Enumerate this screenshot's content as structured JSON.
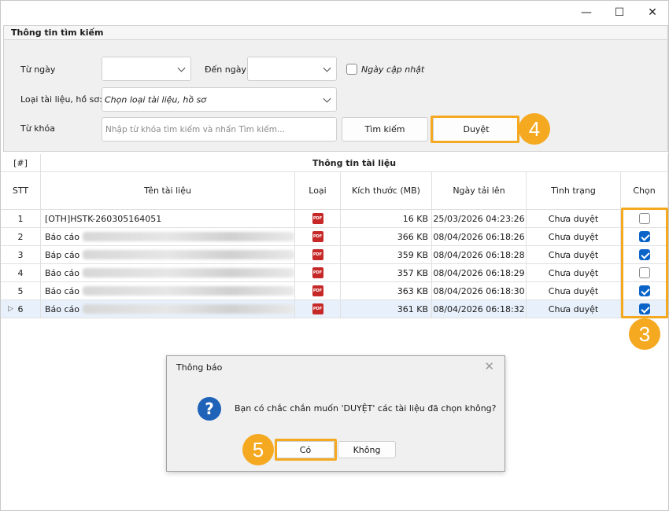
{
  "window": {
    "minimize_glyph": "—",
    "maximize_glyph": "☐",
    "close_glyph": "✕"
  },
  "search": {
    "title": "Thông tin tìm kiếm",
    "from_date_label": "Từ ngày",
    "to_date_label": "Đến ngày",
    "update_date_label": "Ngày cập nhật",
    "doc_type_label": "Loại tài liệu, hồ sơ:",
    "doc_type_value": "Chọn loại tài liệu, hồ sơ",
    "keyword_label": "Từ khóa",
    "keyword_placeholder": "Nhập từ khóa tìm kiếm và nhấn Tìm kiếm...",
    "search_button": "Tìm kiếm",
    "approve_button": "Duyệt"
  },
  "grid": {
    "corner": "[#]",
    "group_header": "Thông tin tài liệu",
    "columns": {
      "stt": "STT",
      "name": "Tên tài liệu",
      "type": "Loại",
      "size": "Kích thước (MB)",
      "date": "Ngày tải lên",
      "status": "Tình trạng",
      "select": "Chọn"
    },
    "rows": [
      {
        "stt": "1",
        "name": "[OTH]HSTK-260305164051",
        "blurred": false,
        "size": "16 KB",
        "date": "25/03/2026 04:23:26",
        "status": "Chưa duyệt",
        "checked": false
      },
      {
        "stt": "2",
        "name": "Báo cáo",
        "blurred": true,
        "size": "366 KB",
        "date": "08/04/2026 06:18:26",
        "status": "Chưa duyệt",
        "checked": true
      },
      {
        "stt": "3",
        "name": "Báp cáo",
        "blurred": true,
        "size": "359 KB",
        "date": "08/04/2026 06:18:28",
        "status": "Chưa duyệt",
        "checked": true
      },
      {
        "stt": "4",
        "name": "Báo cáo",
        "blurred": true,
        "size": "357 KB",
        "date": "08/04/2026 06:18:29",
        "status": "Chưa duyệt",
        "checked": false
      },
      {
        "stt": "5",
        "name": "Báo cáo",
        "blurred": true,
        "size": "363 KB",
        "date": "08/04/2026 06:18:30",
        "status": "Chưa duyệt",
        "checked": true
      },
      {
        "stt": "6",
        "name": "Báo cáo",
        "blurred": true,
        "size": "361 KB",
        "date": "08/04/2026 06:18:32",
        "status": "Chưa duyệt",
        "checked": true,
        "current": true
      }
    ],
    "row_indicator": "▷"
  },
  "dialog": {
    "title": "Thông báo",
    "close_glyph": "✕",
    "icon_glyph": "?",
    "message": "Bạn có chắc chắn muốn 'DUYỆT' các tài liệu đã chọn không?",
    "yes_button": "Có",
    "no_button": "Không"
  },
  "annotations": {
    "step_3": "3",
    "step_4": "4",
    "step_5": "5"
  },
  "colors": {
    "highlight": "#f4a921",
    "check": "#0a64c8",
    "pdf": "#c62828",
    "dialog_icon": "#1e63b8"
  }
}
